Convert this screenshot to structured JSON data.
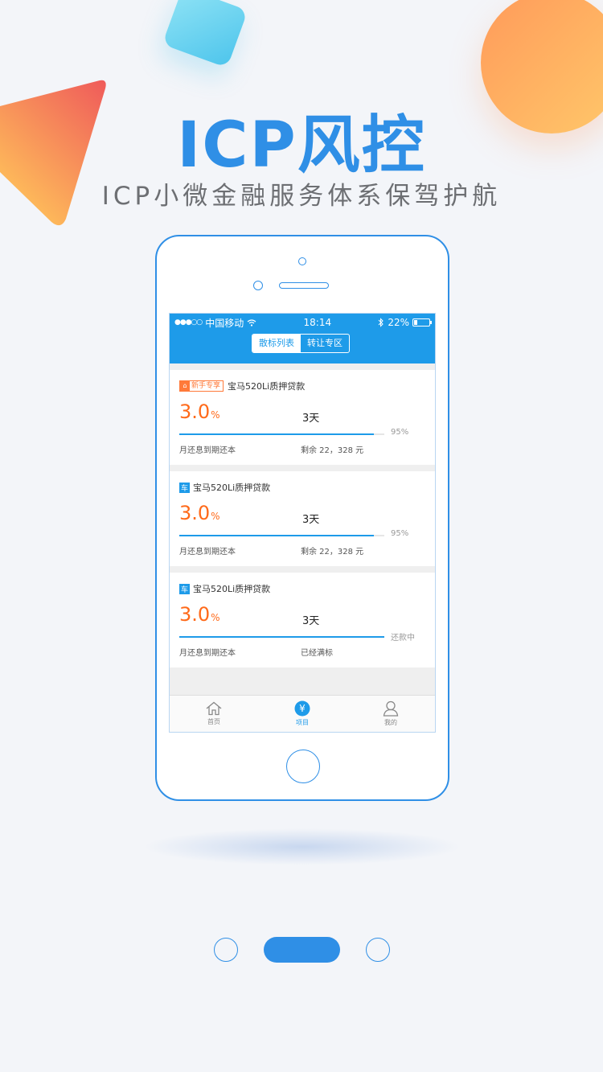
{
  "hero": {
    "title": "ICP风控",
    "subtitle": "ICP小微金融服务体系保驾护航"
  },
  "status_bar": {
    "carrier": "中国移动",
    "time": "18:14",
    "battery": "22%",
    "battery_level": 0.22
  },
  "segments": [
    {
      "label": "散标列表",
      "active": true
    },
    {
      "label": "转让专区",
      "active": false
    }
  ],
  "cards": [
    {
      "badge_type": "new",
      "badge_label": "新手专享",
      "title": "宝马520Li质押贷款",
      "rate": "3.0",
      "rate_unit": "%",
      "period": "3天",
      "progress": 0.95,
      "progress_label": "95%",
      "repay_method": "月还息到期还本",
      "remaining": "剩余 22，328 元"
    },
    {
      "badge_type": "car",
      "badge_label": "车",
      "title": "宝马520Li质押贷款",
      "rate": "3.0",
      "rate_unit": "%",
      "period": "3天",
      "progress": 0.95,
      "progress_label": "95%",
      "repay_method": "月还息到期还本",
      "remaining": "剩余 22，328 元"
    },
    {
      "badge_type": "car",
      "badge_label": "车",
      "title": "宝马520Li质押贷款",
      "rate": "3.0",
      "rate_unit": "%",
      "period": "3天",
      "progress": 1.0,
      "progress_label": "还款中",
      "repay_method": "月还息到期还本",
      "remaining": "已经满标"
    }
  ],
  "tabs": [
    {
      "label": "首页",
      "icon": "home-icon",
      "active": false
    },
    {
      "label": "项目",
      "icon": "yen-icon",
      "active": true
    },
    {
      "label": "我的",
      "icon": "user-icon",
      "active": false
    }
  ],
  "pager": {
    "count": 3,
    "active_index": 1
  },
  "colors": {
    "brand_blue": "#2f8fe6",
    "app_blue": "#1e9be9",
    "rate_orange": "#ff6a1a",
    "background": "#f3f5f9"
  }
}
